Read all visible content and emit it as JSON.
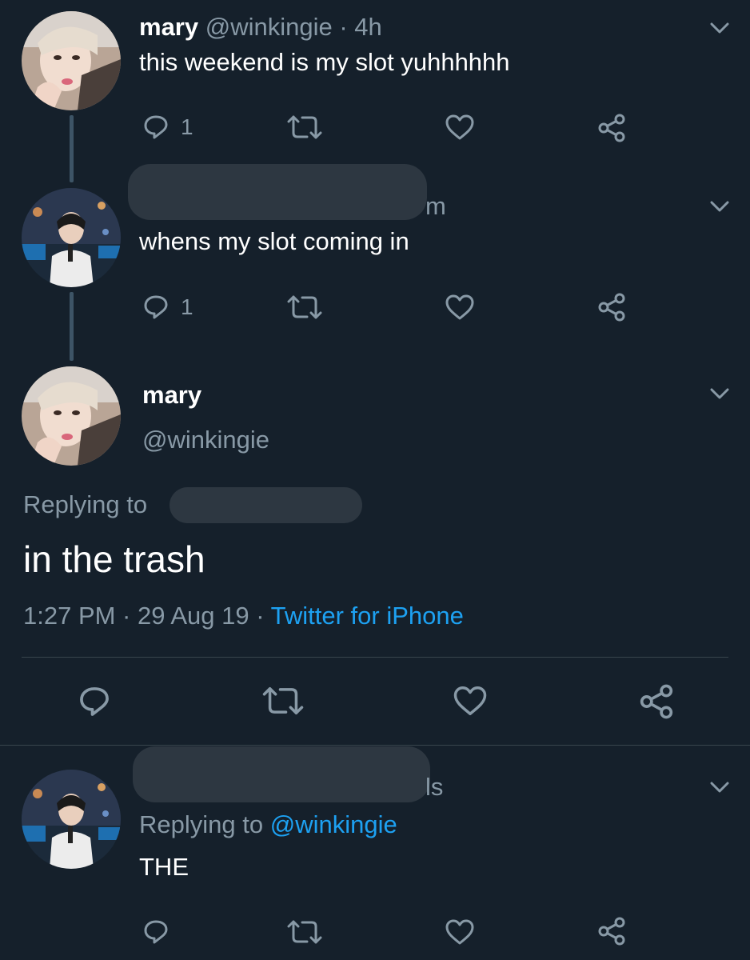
{
  "tweet1": {
    "name": "mary",
    "handle": "@winkingie",
    "time": "· 4h",
    "text": "this weekend is my slot yuhhhhhh",
    "reply_count": "1"
  },
  "tweet2": {
    "name_tail": "m",
    "text": "whens my slot coming in",
    "reply_count": "1"
  },
  "main_tweet": {
    "name": "mary",
    "handle": "@winkingie",
    "replying_label": "Replying to",
    "text": "in the trash",
    "time": "1:27 PM · 29 Aug 19 · ",
    "source": "Twitter for iPhone"
  },
  "reply_tweet": {
    "name_tail": "ls",
    "replying_label": "Replying to",
    "replying_handle": "@winkingie",
    "text": "THE"
  },
  "colors": {
    "background": "#15202b",
    "muted": "#8899a6",
    "link": "#1da1f2"
  },
  "icons": [
    "reply-icon",
    "retweet-icon",
    "like-icon",
    "share-icon",
    "chevron-down-icon"
  ]
}
